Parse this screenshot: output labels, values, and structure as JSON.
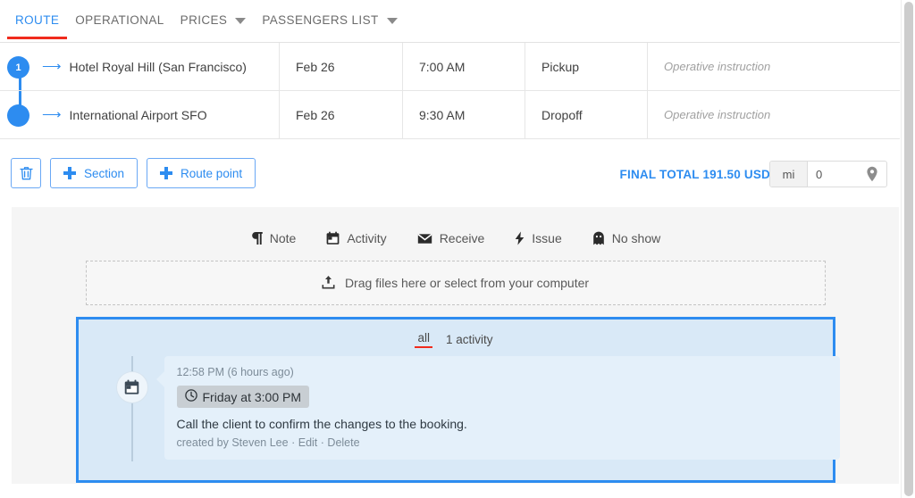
{
  "tabs": [
    {
      "label": "ROUTE",
      "active": true,
      "caret": false
    },
    {
      "label": "OPERATIONAL",
      "active": false,
      "caret": false
    },
    {
      "label": "PRICES",
      "active": false,
      "caret": true
    },
    {
      "label": "PASSENGERS LIST",
      "active": false,
      "caret": true
    }
  ],
  "route": {
    "rows": [
      {
        "marker": "1",
        "name": "Hotel Royal Hill (San Francisco)",
        "date": "Feb 26",
        "time": "7:00 AM",
        "type": "Pickup",
        "instruction": "Operative instruction"
      },
      {
        "marker": "",
        "name": "International Airport SFO",
        "date": "Feb 26",
        "time": "9:30 AM",
        "type": "Dropoff",
        "instruction": "Operative instruction"
      }
    ]
  },
  "toolbar": {
    "delete_label": "",
    "section_label": "Section",
    "route_point_label": "Route point",
    "final_total": "FINAL TOTAL 191.50 USD",
    "distance_unit": "mi",
    "distance_value": "0"
  },
  "actions": [
    {
      "label": "Note",
      "icon": "pilcrow-icon"
    },
    {
      "label": "Activity",
      "icon": "calendar-icon"
    },
    {
      "label": "Receive",
      "icon": "envelope-icon"
    },
    {
      "label": "Issue",
      "icon": "bolt-icon"
    },
    {
      "label": "No show",
      "icon": "ghost-icon"
    }
  ],
  "dropzone": {
    "label": "Drag files here or select from your computer"
  },
  "activity": {
    "tab_all": "all",
    "count_label": "1 activity",
    "entry": {
      "time": "12:58 PM (6 hours ago)",
      "badge": "Friday at 3:00 PM",
      "text": "Call the client to confirm the changes to the booking.",
      "author": "created by Steven Lee",
      "sep1": "·",
      "edit": "Edit",
      "sep2": "·",
      "delete": "Delete"
    }
  },
  "colors": {
    "accent_blue": "#2d8cf0",
    "active_red": "#f02b1d",
    "panel_bg": "#f5f5f5",
    "activity_bg": "#d9e9f7",
    "card_bg": "#e4f0fa"
  }
}
